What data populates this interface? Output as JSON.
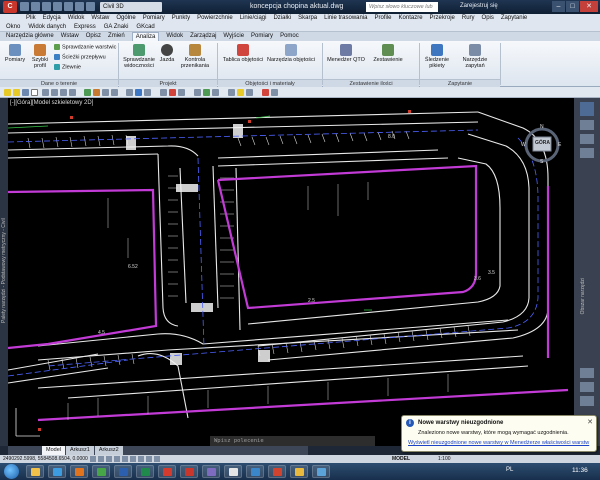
{
  "title_bar": {
    "app_letter": "C",
    "workspace": "Civil 3D",
    "document": "koncepcja chopina aktual.dwg",
    "search_placeholder": "Wpisz słowo kluczowe lub frazę",
    "signin": "Zarejestruj się"
  },
  "menu_row1": [
    "Plik",
    "Edycja",
    "Widok",
    "Wstaw",
    "Ogólne",
    "Pomiary",
    "Punkty",
    "Powierzchnie",
    "Linie/ciągi",
    "Działki",
    "Skarpa",
    "Linie trasowania",
    "Profile",
    "Kontazre",
    "Przekroje",
    "Rury",
    "Opis",
    "Zapytanie"
  ],
  "menu_row2": [
    "Okno",
    "Widok danych",
    "Express",
    "GA Znaki",
    "GKcad"
  ],
  "ribbon_tabs": [
    "Narzędzia główne",
    "Wstaw",
    "Opisz",
    "Zmień",
    "Analiza",
    "Widok",
    "Zarządzaj",
    "Wyjście",
    "Pomiary",
    "Pomoc"
  ],
  "ribbon_active_tab": "Analiza",
  "ribbon": {
    "pomiary": "Pomiary",
    "szybki_profil": "Szybki profil",
    "sprawdzanie_warstwic": "Sprawdzanie warstwic",
    "sciezki_przeplywu": "Ścieżki przepływu",
    "zlewnie": "Zlewnie",
    "group_dane": "Dane o terenie",
    "sprawdzanie_widocznosci": "Sprawdzanie widoczności",
    "jazda": "Jazda",
    "kontrola_przenikania": "Kontrola przenikania",
    "group_projekt": "Projekt",
    "tablica_objetosci": "Tablica objętości",
    "narzedzia_objetosci": "Narzędzia objętości",
    "group_objetosci": "Objętości i materiały",
    "menedzer_qto": "Menedżer QTO",
    "zestawienie": "Zestawienie",
    "group_ilosci": "Zestawienie ilości",
    "sledzenie_pikiety": "Śledzenie pikiety",
    "narzedzie_zapytan": "Narzędzie zapytań",
    "group_zapytanie": "Zapytanie"
  },
  "viewport_label": "[-][Góra][Model szkieletowy 2D]",
  "left_strip_label": "Palety narzędzi - Podstawowy metryczny - Civil",
  "navcube": {
    "face": "GÓRA",
    "north": "N",
    "west": "W",
    "east": "E",
    "south": "S",
    "wcs": "WCS"
  },
  "right_panel_label": "Obszar narzędzi",
  "command_prompt": "Wpisz polecenie",
  "layout_tabs": [
    "Model",
    "Arkusz1",
    "Arkusz2"
  ],
  "status": {
    "coords": "2490292.5998, 5584508.6504, 0.0000",
    "model_space": "MODEL",
    "scale": "1:100"
  },
  "balloon": {
    "title": "Nowe warstwy nieuzgodnione",
    "message": "Znaleziono nowe warstwy, które mogą wymagać uzgodnienia.",
    "link": "Wyświetl nieuzgodnione nowe warstwy w Menedżerze właściwości warstw"
  },
  "taskbar": {
    "language": "PL",
    "time": "11:36"
  },
  "drawing_annotations": [
    "6.52",
    "4.5",
    "3.5",
    "2.5",
    "3.6",
    "8.0"
  ],
  "colors": {
    "boundary": "#c23bd6",
    "roads": "#e8e8e8",
    "axis": "#4d63ff",
    "background": "#000000",
    "accent_red": "#d23a2a"
  }
}
